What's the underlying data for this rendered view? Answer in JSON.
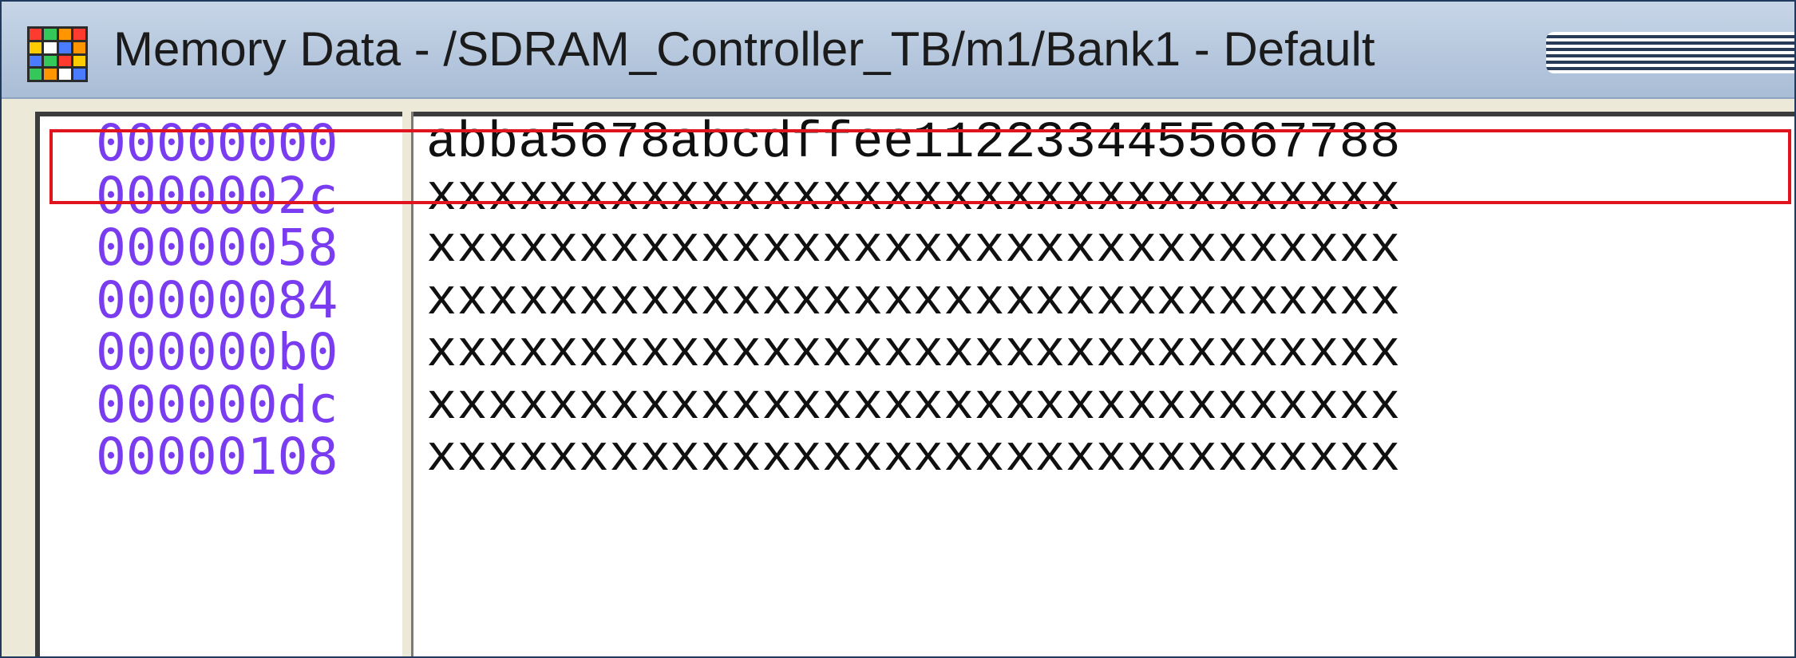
{
  "window": {
    "title": "Memory Data - /SDRAM_Controller_TB/m1/Bank1 - Default",
    "icon": "memory-grid-icon"
  },
  "memory": {
    "rows": [
      {
        "address": "00000000",
        "words": [
          "abba",
          "5678",
          "abcd",
          "ffee",
          "1122",
          "3344",
          "5566",
          "7788"
        ]
      },
      {
        "address": "0000002c",
        "words": [
          "xxxx",
          "xxxx",
          "xxxx",
          "xxxx",
          "xxxx",
          "xxxx",
          "xxxx",
          "xxxx"
        ]
      },
      {
        "address": "00000058",
        "words": [
          "xxxx",
          "xxxx",
          "xxxx",
          "xxxx",
          "xxxx",
          "xxxx",
          "xxxx",
          "xxxx"
        ]
      },
      {
        "address": "00000084",
        "words": [
          "xxxx",
          "xxxx",
          "xxxx",
          "xxxx",
          "xxxx",
          "xxxx",
          "xxxx",
          "xxxx"
        ]
      },
      {
        "address": "000000b0",
        "words": [
          "xxxx",
          "xxxx",
          "xxxx",
          "xxxx",
          "xxxx",
          "xxxx",
          "xxxx",
          "xxxx"
        ]
      },
      {
        "address": "000000dc",
        "words": [
          "xxxx",
          "xxxx",
          "xxxx",
          "xxxx",
          "xxxx",
          "xxxx",
          "xxxx",
          "xxxx"
        ]
      },
      {
        "address": "00000108",
        "words": [
          "xxxx",
          "xxxx",
          "xxxx",
          "xxxx",
          "xxxx",
          "xxxx",
          "xxxx",
          "xxxx"
        ]
      }
    ]
  },
  "colors": {
    "address_text": "#7a3cf0",
    "highlight_border": "#e0141e",
    "titlebar": "#b8c9df"
  }
}
